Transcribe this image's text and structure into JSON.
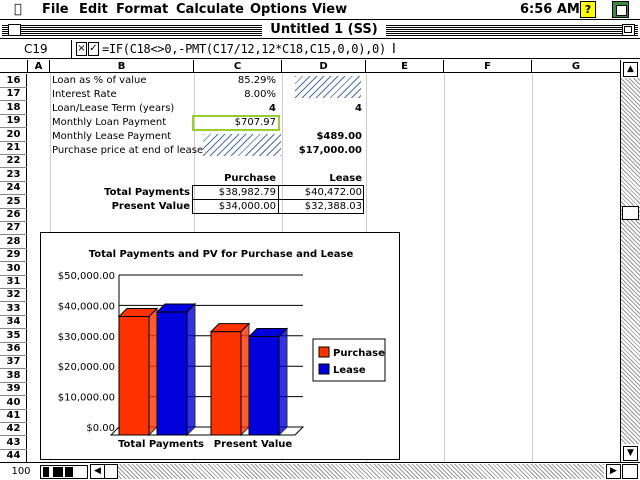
{
  "menubar": {
    "apple": "",
    "items": [
      "File",
      "Edit",
      "Format",
      "Calculate",
      "Options",
      "View"
    ],
    "clock": "6:56 AM",
    "help": "?"
  },
  "window": {
    "title": "Untitled 1 (SS)"
  },
  "formula_bar": {
    "cell_ref": "C19",
    "cancel": "×",
    "accept": "✓",
    "formula": "=IF(C18<>0,-PMT(C17/12,12*C18,C15,0,0),0)"
  },
  "columns": [
    "A",
    "B",
    "C",
    "D",
    "E",
    "F",
    "G"
  ],
  "rows": [
    "16",
    "17",
    "18",
    "19",
    "20",
    "21",
    "22",
    "23",
    "24",
    "25",
    "26",
    "27",
    "28",
    "29",
    "30",
    "31",
    "32",
    "33",
    "34",
    "35",
    "36",
    "37",
    "38",
    "39",
    "40",
    "41",
    "42",
    "43",
    "44"
  ],
  "sheet": {
    "r16": {
      "label": "Loan as % of value",
      "c": "85.29%"
    },
    "r17": {
      "label": "Interest Rate",
      "c": "8.00%"
    },
    "r18": {
      "label": "Loan/Lease Term (years)",
      "c": "4",
      "d": "4"
    },
    "r19": {
      "label": "Monthly Loan Payment",
      "c": "$707.97"
    },
    "r20": {
      "label": "Monthly Lease Payment",
      "d": "$489.00"
    },
    "r21": {
      "label": "Purchase price at end of lease",
      "d": "$17,000.00"
    },
    "r24": {
      "c": "Purchase",
      "d": "Lease"
    },
    "r25": {
      "label": "Total Payments",
      "c": "$38,982.79",
      "d": "$40,472.00"
    },
    "r26": {
      "label": "Present Value",
      "c": "$34,000.00",
      "d": "$32,388.03"
    }
  },
  "zoom": "100",
  "chart_data": {
    "type": "bar",
    "title": "Total Payments and PV for Purchase and Lease",
    "categories": [
      "Total Payments",
      "Present Value"
    ],
    "series": [
      {
        "name": "Purchase",
        "values": [
          38982.79,
          34000.0
        ],
        "color": "#ff3300"
      },
      {
        "name": "Lease",
        "values": [
          40472.0,
          32388.03
        ],
        "color": "#0000dd"
      }
    ],
    "y_ticks": [
      "$0.00",
      "$10,000.00",
      "$20,000.00",
      "$30,000.00",
      "$40,000.00",
      "$50,000.00"
    ],
    "ylim": [
      0,
      50000
    ],
    "legend_position": "right",
    "grid": true,
    "style": "3d"
  }
}
